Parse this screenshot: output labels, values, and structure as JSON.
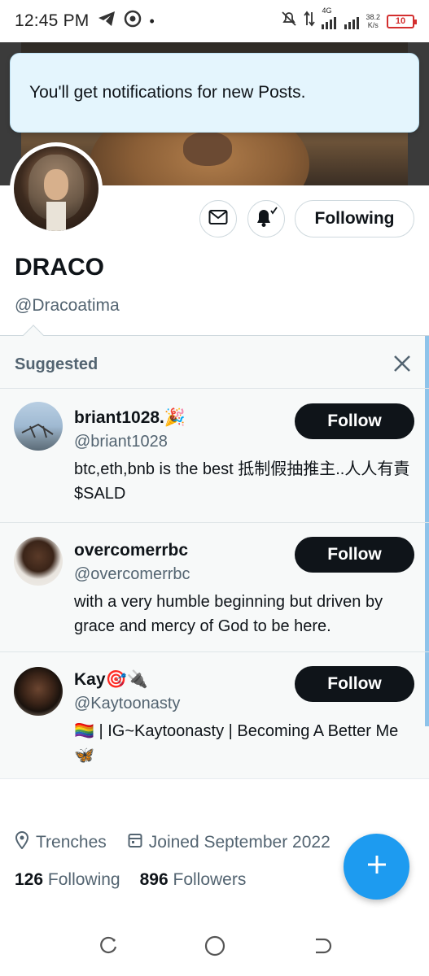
{
  "status_bar": {
    "time": "12:45 PM",
    "network": "4G",
    "speed_value": "38.2",
    "speed_unit": "K/s",
    "battery": "10"
  },
  "toast": {
    "message": "You'll get notifications for new Posts."
  },
  "profile": {
    "name": "DRACO",
    "handle": "@Dracoatima",
    "following_button": "Following",
    "location": "Trenches",
    "joined": "Joined September 2022",
    "following_count": "126",
    "following_label": "Following",
    "followers_count": "896",
    "followers_label": "Followers"
  },
  "suggested": {
    "title": "Suggested",
    "follow_label": "Follow",
    "users": [
      {
        "name": "briant1028.🎉",
        "handle": "@briant1028",
        "bio": "btc,eth,bnb is the best 抵制假抽推主..人人有責 $SALD"
      },
      {
        "name": "overcomerrbc",
        "handle": "@overcomerrbc",
        "bio": "with a very humble beginning but driven by grace and mercy of God to be here."
      },
      {
        "name": "Kay🎯🔌",
        "handle": "@Kaytoonasty",
        "bio": "🏳️‍🌈 | IG~Kaytoonasty | Becoming A Better Me 🦋"
      }
    ]
  },
  "colors": {
    "accent": "#1d9bf0",
    "text": "#0f1419",
    "muted": "#536471",
    "toast_bg": "#e4f5fd"
  },
  "icons": [
    "telegram-icon",
    "vpn-icon",
    "mute-icon",
    "data-icon",
    "signal-icon",
    "mail-icon",
    "bell-icon",
    "close-icon",
    "location-icon",
    "calendar-icon",
    "plus-icon",
    "recents-icon",
    "home-icon",
    "back-icon"
  ]
}
